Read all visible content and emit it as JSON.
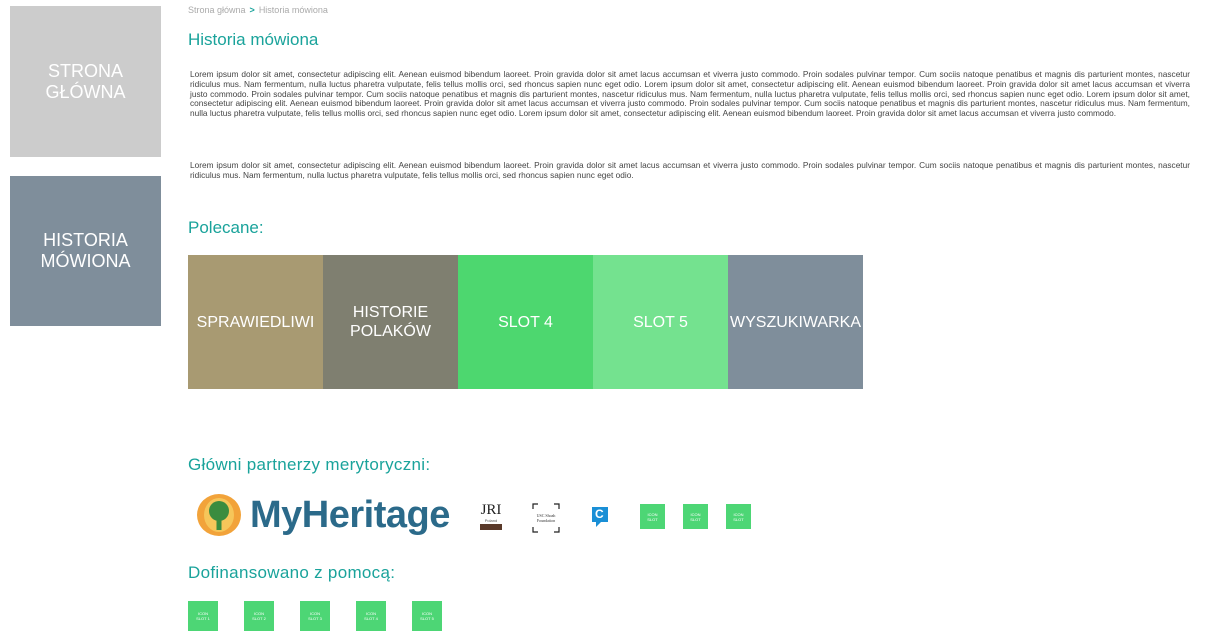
{
  "sidebar": {
    "home_label": "STRONA GŁÓWNA",
    "history_label": "HISTORIA MÓWIONA"
  },
  "breadcrumb": {
    "home": "Strona główna",
    "separator": ">",
    "current": "Historia mówiona"
  },
  "page": {
    "title": "Historia mówiona",
    "paragraph1": "Lorem ipsum dolor sit amet, consectetur adipiscing elit. Aenean euismod bibendum laoreet. Proin gravida dolor sit amet lacus accumsan et viverra justo commodo. Proin sodales pulvinar tempor. Cum sociis natoque penatibus et magnis dis parturient montes, nascetur ridiculus mus. Nam fermentum, nulla luctus pharetra vulputate, felis tellus mollis orci, sed rhoncus sapien nunc eget odio. Lorem ipsum dolor sit amet, consectetur adipiscing elit. Aenean euismod bibendum laoreet. Proin gravida dolor sit amet lacus accumsan et viverra justo commodo. Proin sodales pulvinar tempor. Cum sociis natoque penatibus et magnis dis parturient montes, nascetur ridiculus mus. Nam fermentum, nulla luctus pharetra vulputate, felis tellus mollis orci, sed rhoncus sapien nunc eget odio. Lorem ipsum dolor sit amet, consectetur adipiscing elit. Aenean euismod bibendum laoreet. Proin gravida dolor sit amet lacus accumsan et viverra justo commodo. Proin sodales pulvinar tempor. Cum sociis natoque penatibus et magnis dis parturient montes, nascetur ridiculus mus. Nam fermentum, nulla luctus pharetra vulputate, felis tellus mollis orci, sed rhoncus sapien nunc eget odio. Lorem ipsum dolor sit amet, consectetur adipiscing elit. Aenean euismod bibendum laoreet. Proin gravida dolor sit amet lacus accumsan et viverra justo commodo.",
    "paragraph2": "Lorem ipsum dolor sit amet, consectetur adipiscing elit. Aenean euismod bibendum laoreet. Proin gravida dolor sit amet lacus accumsan et viverra justo commodo. Proin sodales pulvinar tempor. Cum sociis natoque penatibus et magnis dis parturient montes, nascetur ridiculus mus. Nam fermentum, nulla luctus pharetra vulputate, felis tellus mollis orci, sed rhoncus sapien nunc eget odio."
  },
  "featured": {
    "heading": "Polecane:",
    "tiles": [
      {
        "line1": "SPRAWIEDLIWI",
        "line2": "",
        "color": "#a89a72"
      },
      {
        "line1": "HISTORIE",
        "line2": "POLAKÓW",
        "color": "#7f7f70"
      },
      {
        "line1": "SLOT 4",
        "line2": "",
        "color": "#4dd76f"
      },
      {
        "line1": "SLOT 5",
        "line2": "",
        "color": "#74e28f"
      },
      {
        "line1": "WYSZUKIWARKA",
        "line2": "",
        "color": "#7f8e9b"
      }
    ]
  },
  "partners": {
    "heading": "Główni partnerzy merytoryczni:",
    "myheritage": "MyHeritage",
    "jri_top": "JRI",
    "jri_bottom": "Poland",
    "usc_line1": "USC Shoah",
    "usc_line2": "Foundation",
    "c_letter": "C",
    "icon_slots": [
      {
        "line1": "ICON",
        "line2": "SLOT"
      },
      {
        "line1": "ICON",
        "line2": "SLOT"
      },
      {
        "line1": "ICON",
        "line2": "SLOT"
      }
    ]
  },
  "funding": {
    "heading": "Dofinansowano z pomocą:",
    "icon_slots": [
      {
        "line1": "ICON",
        "line2": "SLOT 1"
      },
      {
        "line1": "ICON",
        "line2": "SLOT 2"
      },
      {
        "line1": "ICON",
        "line2": "SLOT 3"
      },
      {
        "line1": "ICON",
        "line2": "SLOT 4"
      },
      {
        "line1": "ICON",
        "line2": "SLOT 5"
      }
    ]
  },
  "colors": {
    "accent": "#1aa39b",
    "sidebar_home": "#cccccc",
    "sidebar_history": "#7f8e9b",
    "slot_green": "#4dd675",
    "myheritage_blue": "#2b6a8a",
    "myheritage_orange": "#f2a33a",
    "myheritage_green": "#3b8c3f"
  }
}
